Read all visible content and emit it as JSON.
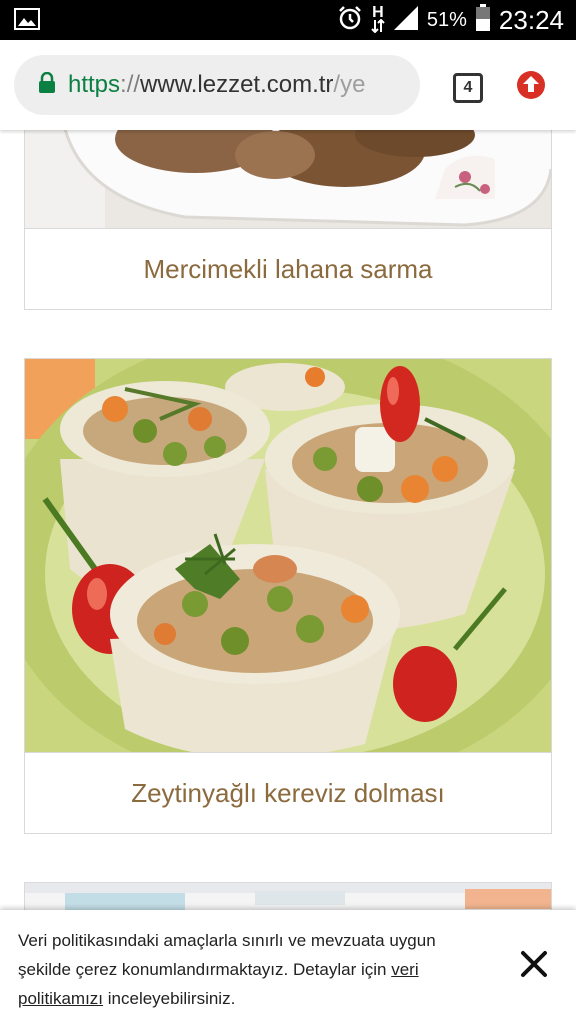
{
  "status_bar": {
    "battery_percent": "51%",
    "time": "23:24",
    "network_label": "H"
  },
  "browser": {
    "url_scheme": "https",
    "url_separator": "://",
    "url_host": "www.lezzet.com.tr",
    "url_path": "/ye",
    "tab_count": "4",
    "accent_color": "#d93025"
  },
  "recipes": [
    {
      "title": "Mercimekli lahana sarma"
    },
    {
      "title": "Zeytinyağlı kereviz dolması"
    }
  ],
  "cookie_banner": {
    "text_before": "Veri politikasındaki amaçlarla sınırlı ve mevzuata uygun şekilde çerez konumlandırmaktayız. Detaylar için ",
    "link_text": "veri politikamızı",
    "text_after": " inceleyebilirsiniz.",
    "close_icon": "close-icon"
  }
}
